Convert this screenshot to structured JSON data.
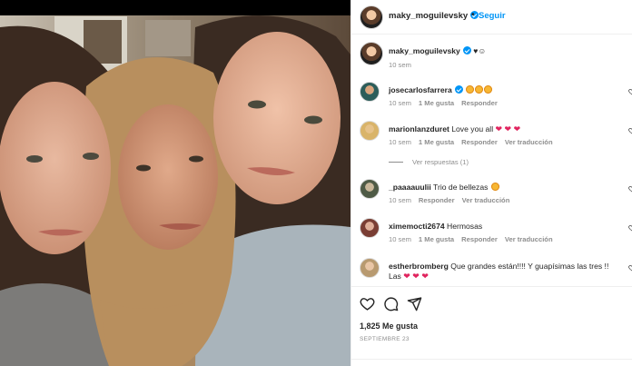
{
  "post": {
    "author": "maky_moguilevsky",
    "follow_label": "Seguir",
    "more_label": "···",
    "dot": "•",
    "caption_text": "♥︎☺︎",
    "caption_time": "10 sem",
    "likes": "1,825 Me gusta",
    "date": "SEPTIEMBRE 23"
  },
  "comments": [
    {
      "user": "josecarlosfarrera",
      "verified": true,
      "text": "",
      "emoji_count": 3,
      "time": "10 sem",
      "likes": "1 Me gusta",
      "reply": "Responder",
      "translate": ""
    },
    {
      "user": "marionlanzduret",
      "verified": false,
      "text": "Love you all",
      "hearts": "❤ ❤ ❤",
      "time": "10 sem",
      "likes": "1 Me gusta",
      "reply": "Responder",
      "translate": "Ver traducción"
    },
    {
      "user": "_paaaauulii",
      "verified": false,
      "text": "Trio de bellezas",
      "emoji_count": 1,
      "time": "10 sem",
      "likes": "",
      "reply": "Responder",
      "translate": "Ver traducción"
    },
    {
      "user": "ximemocti2674",
      "verified": false,
      "text": "Hermosas",
      "time": "10 sem",
      "likes": "1 Me gusta",
      "reply": "Responder",
      "translate": "Ver traducción"
    },
    {
      "user": "estherbromberg",
      "verified": false,
      "text": "Que grandes están!!!! Y guapísimas las tres !! Las",
      "hearts": "❤ ❤ ❤",
      "time": "",
      "likes": "",
      "reply": "",
      "translate": ""
    }
  ],
  "view_replies": "Ver respuestas (1)",
  "icons": [
    "heart-icon",
    "comment-icon",
    "share-icon",
    "bookmark-icon"
  ],
  "colors": {
    "accent": "#0095f6",
    "heart": "#e0245e",
    "muted": "#8e8e8e"
  }
}
